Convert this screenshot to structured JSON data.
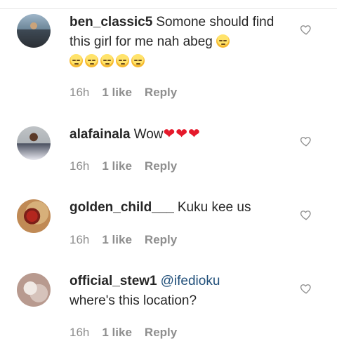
{
  "comments": [
    {
      "username": "ben_classic5",
      "text": "Somone should find this girl for me nah abeg",
      "emoji_name": "pensive-face-emoji",
      "emoji_count": 6,
      "time": "16h",
      "likes": "1 like",
      "reply": "Reply"
    },
    {
      "username": "alafainala",
      "text": "Wow",
      "hearts": "❤❤❤",
      "time": "16h",
      "likes": "1 like",
      "reply": "Reply"
    },
    {
      "username": "golden_child___",
      "text": "Kuku kee us",
      "time": "16h",
      "likes": "1 like",
      "reply": "Reply"
    },
    {
      "username": "official_stew1",
      "mention": "@ifedioku",
      "text": "where's this location?",
      "time": "16h",
      "likes": "1 like",
      "reply": "Reply"
    }
  ],
  "colors": {
    "text": "#262626",
    "meta": "#8e8e8e",
    "mention": "#1f4e79",
    "heart": "#e5192b"
  },
  "icons": {
    "like": "heart-outline-icon"
  }
}
